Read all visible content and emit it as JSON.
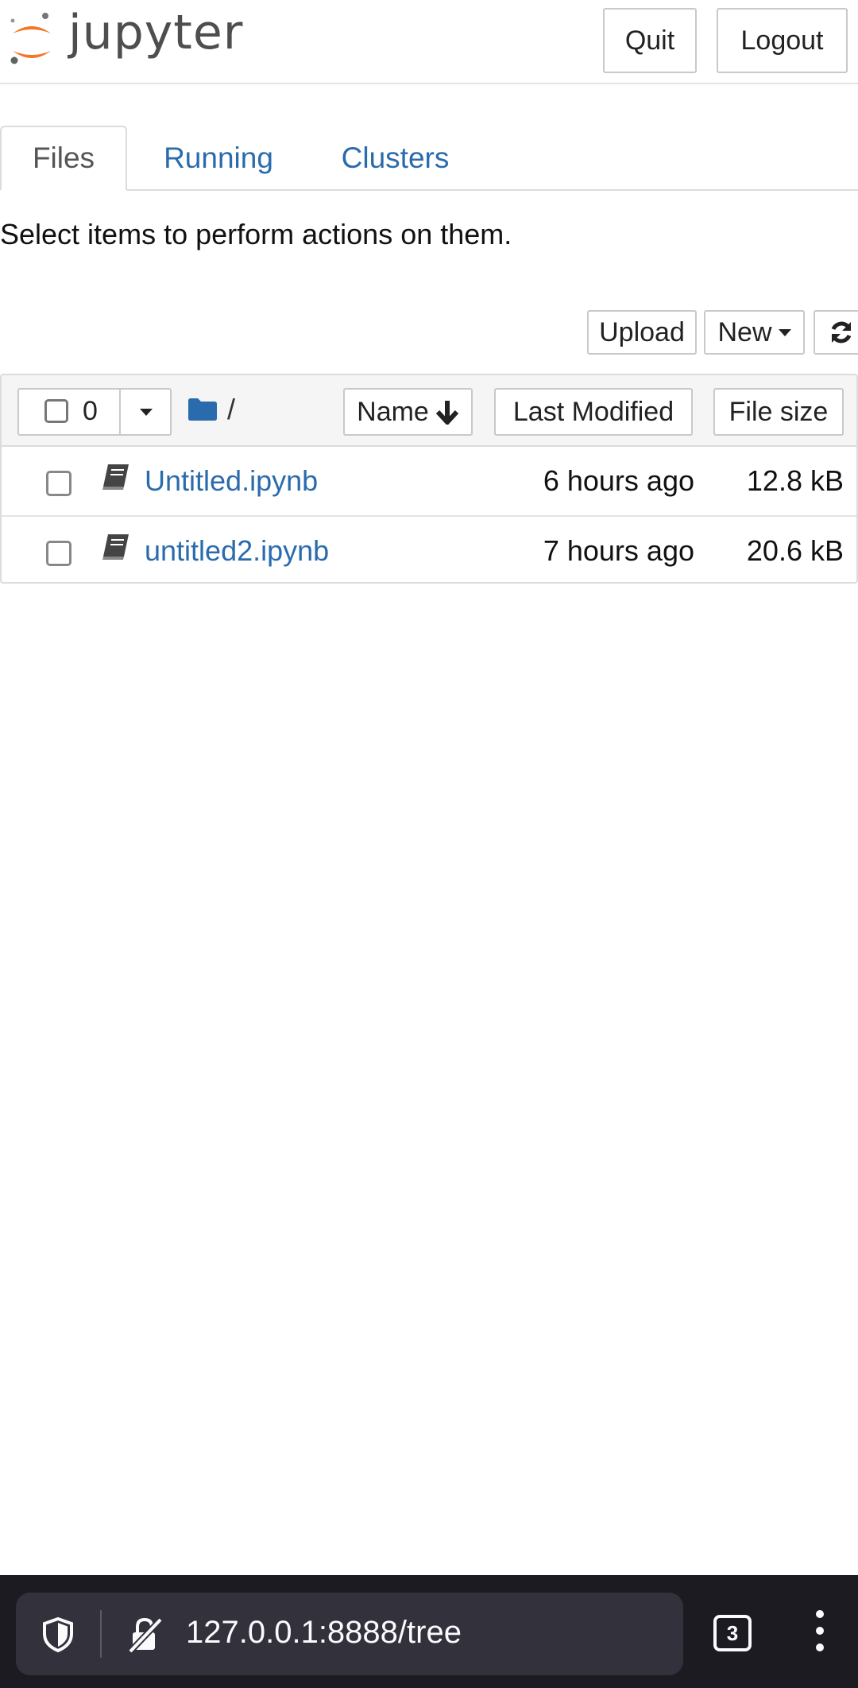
{
  "header": {
    "logo_text": "jupyter",
    "quit_label": "Quit",
    "logout_label": "Logout"
  },
  "tabs": [
    {
      "label": "Files",
      "active": true
    },
    {
      "label": "Running",
      "active": false
    },
    {
      "label": "Clusters",
      "active": false
    }
  ],
  "instructions": "Select items to perform actions on them.",
  "toolbar": {
    "upload_label": "Upload",
    "new_label": "New",
    "refresh_icon": "refresh-icon"
  },
  "list_header": {
    "selected_count": "0",
    "breadcrumb": "/",
    "name_label": "Name",
    "last_modified_label": "Last Modified",
    "file_size_label": "File size"
  },
  "files": [
    {
      "name": "Untitled.ipynb",
      "modified": "6 hours ago",
      "size": "12.8 kB",
      "icon": "notebook-icon"
    },
    {
      "name": "untitled2.ipynb",
      "modified": "7 hours ago",
      "size": "20.6 kB",
      "icon": "notebook-icon"
    }
  ],
  "browser": {
    "url": "127.0.0.1:8888/tree",
    "tab_count": "3"
  },
  "colors": {
    "link": "#2a6bad",
    "logo_orange": "#f37726",
    "bottom_bar": "#1c1b22"
  }
}
